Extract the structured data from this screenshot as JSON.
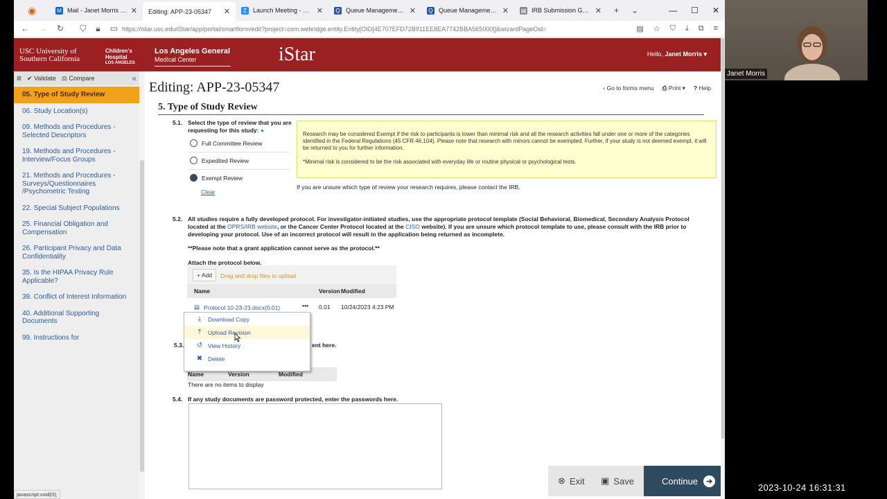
{
  "browser": {
    "tabs": [
      {
        "title": "",
        "icon_color": "#e66000"
      },
      {
        "title": "Mail - Janet Morris - Outlook",
        "icon_color": "#1565c0"
      },
      {
        "title": "Editing: APP-23-05347",
        "icon_color": "#ffffff"
      },
      {
        "title": "Launch Meeting - Zoom",
        "icon_color": "#2d8cff"
      },
      {
        "title": "Queue Management Workb...",
        "icon_color": "#2b579a"
      },
      {
        "title": "Queue Management Workb...",
        "icon_color": "#2b579a"
      },
      {
        "title": "IRB Submission Guidelines",
        "icon_color": "#888888"
      }
    ],
    "url": "https://istar.usc.edu/iStar/app/portal/smartform/edit?project=com.webridge.entity.Entity[OID[4E707EFD72B911EE8EA7742BBA565000]]&wizardPageOid=",
    "status_text": "javascript:void(0);"
  },
  "banner": {
    "usc_line1": "USC University of",
    "usc_line2": "Southern California",
    "chla_line1": "Children's",
    "chla_line2": "Hospital",
    "chla_line3": "LOS ANGELES",
    "lagmc_line1": "Los Angeles General",
    "lagmc_line2": "Medical Center",
    "app_name": "iStar",
    "hello_prefix": "Hello,",
    "user_name": "Janet Morris ▾"
  },
  "leftnav": {
    "validate": "Validate",
    "compare": "Compare",
    "items": [
      "05. Type of Study Review",
      "06. Study Location(s)",
      "09. Methods and Procedures - Selected Descriptors",
      "19. Methods and Procedures - Interview/Focus Groups",
      "21. Methods and Procedures - Surveys/Questionnaires /Psychometric Testing",
      "22. Special Subject Populations",
      "25. Financial Obligation and Compensation",
      "26. Participant Privacy and Data Confidentiality",
      "35. Is the HIPAA Privacy Rule Applicable?",
      "39. Conflict of Interest Information",
      "40. Additional Supporting Documents",
      "99. Instructions for"
    ]
  },
  "page": {
    "title": "Editing: APP-23-05347",
    "go_to_forms": "Go to forms menu",
    "print": "Print ▾",
    "help": "Help",
    "section_title": "5. Type of Study Review"
  },
  "q51": {
    "num": "5.1.",
    "text": "Select the type of review that you are requesting for this study:",
    "options": [
      "Full Committee Review",
      "Expedited Review",
      "Exempt Review"
    ],
    "selected": "Exempt Review",
    "clear": "Clear",
    "note1": "Research may be considered Exempt if the risk to participants is lower than minimal risk and all the research activities fall under one or more of the categories identified in the Federal Regulations (45 CFR 46.104). Please note that research with minors cannot be exempted. Further, if your study is not deemed exempt, it will be returned to you for further information.",
    "note2": "*Minimal risk is considered to be the risk associated with everyday life or routine physical or psychological tests.",
    "unsure": "If you are unsure which type of review your research requires, please contact the IRB."
  },
  "q52": {
    "num": "5.2.",
    "text_a": "All studies require a fully developed protocol. For investigator-initiated studies, use the appropriate protocol template (Social Behavioral, Biomedical, Secondary Analysis Protocol located at the ",
    "link1": "OPRS/IRB website",
    "text_b": ", or the Cancer Center Protocol located at the ",
    "link2": "CISO",
    "text_c": " website). If you are unsure which protocol template to use, please consult with the IRB prior to developing your protocol. Use of an incorrect protocol will result in the application being returned as incomplete.",
    "grant_note": "**Please note that a grant application cannot serve as the protocol.**",
    "attach_label": "Attach the protocol below.",
    "add": "+ Add",
    "drag": "Drag and drop files to upload",
    "col_name": "Name",
    "col_version": "Version",
    "col_modified": "Modified",
    "file": {
      "name": "Protocol 10-23-23.docx(0.01)",
      "version": "0.01",
      "modified": "10/24/2023 4:23 PM"
    }
  },
  "context_menu": [
    "Download Copy",
    "Upload Revision",
    "View History",
    "Delete"
  ],
  "q53": {
    "num": "5.3.",
    "text_tail": "ent here.",
    "col_name": "Name",
    "col_version": "Version",
    "col_modified": "Modified",
    "empty": "There are no items to display"
  },
  "q54": {
    "num": "5.4.",
    "text": "If any study documents are password protected, enter the passwords here."
  },
  "footer": {
    "exit": "Exit",
    "save": "Save",
    "continue": "Continue"
  },
  "video": {
    "participant": "Janet Morris"
  },
  "clock": "2023-10-24  16:31:31"
}
